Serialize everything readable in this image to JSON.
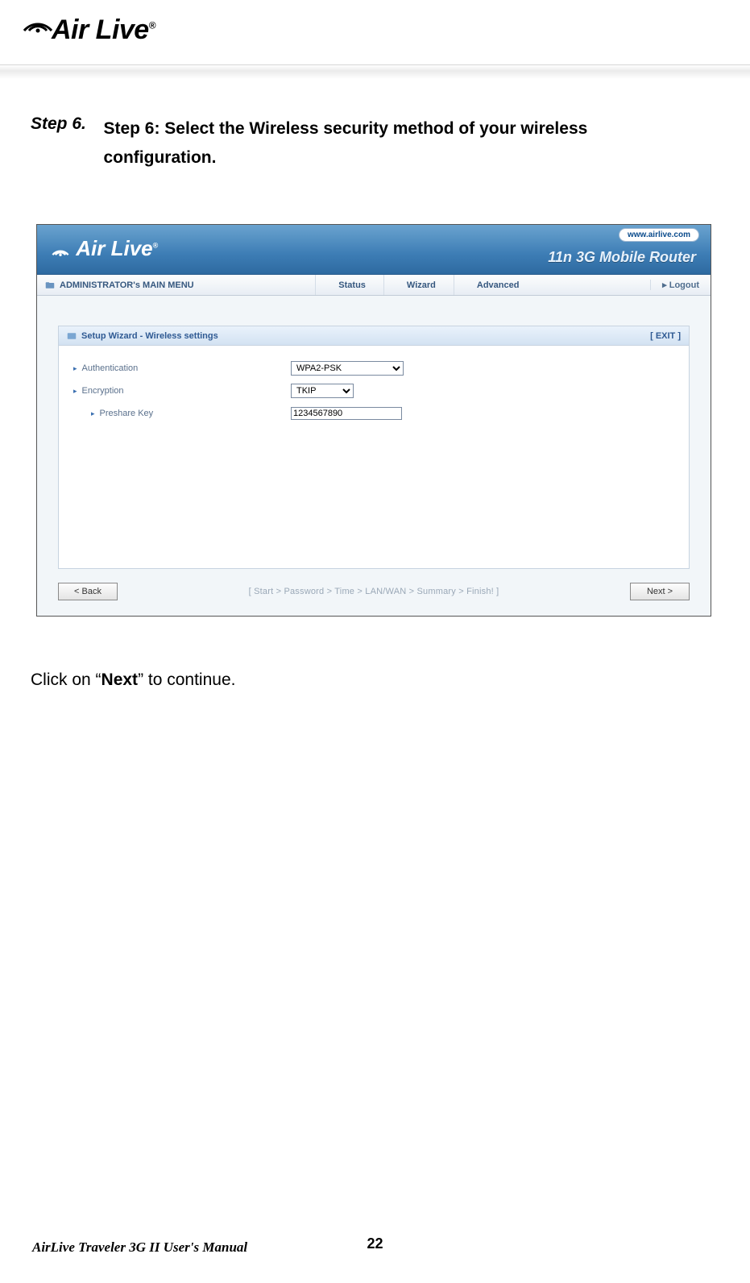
{
  "page": {
    "logo_text": "Air Live",
    "logo_reg": "®",
    "manual_footer": "AirLive Traveler 3G II User's Manual",
    "page_number": "22"
  },
  "step": {
    "label": "Step 6.",
    "text": "Step 6: Select the Wireless security method of your wireless configuration."
  },
  "continue": {
    "prefix": "Click on “",
    "bold": "Next",
    "suffix": "” to continue."
  },
  "screenshot": {
    "brand": "Air Live",
    "brand_reg": "®",
    "url_pill": "www.airlive.com",
    "subtitle": "11n 3G Mobile Router",
    "toolbar": {
      "main_menu": "ADMINISTRATOR's MAIN MENU",
      "status": "Status",
      "wizard": "Wizard",
      "advanced": "Advanced",
      "logout_prefix": "▸ ",
      "logout": "Logout"
    },
    "panel": {
      "title": "Setup Wizard - Wireless settings",
      "exit": "[ EXIT ]",
      "rows": {
        "authentication": {
          "label": "Authentication",
          "value": "WPA2-PSK"
        },
        "encryption": {
          "label": "Encryption",
          "value": "TKIP"
        },
        "preshare": {
          "label": "Preshare Key",
          "value": "1234567890"
        }
      }
    },
    "footer": {
      "back": "< Back",
      "crumbs": "[ Start > Password > Time > LAN/WAN >                 Summary > Finish! ]",
      "next": "Next >"
    }
  }
}
